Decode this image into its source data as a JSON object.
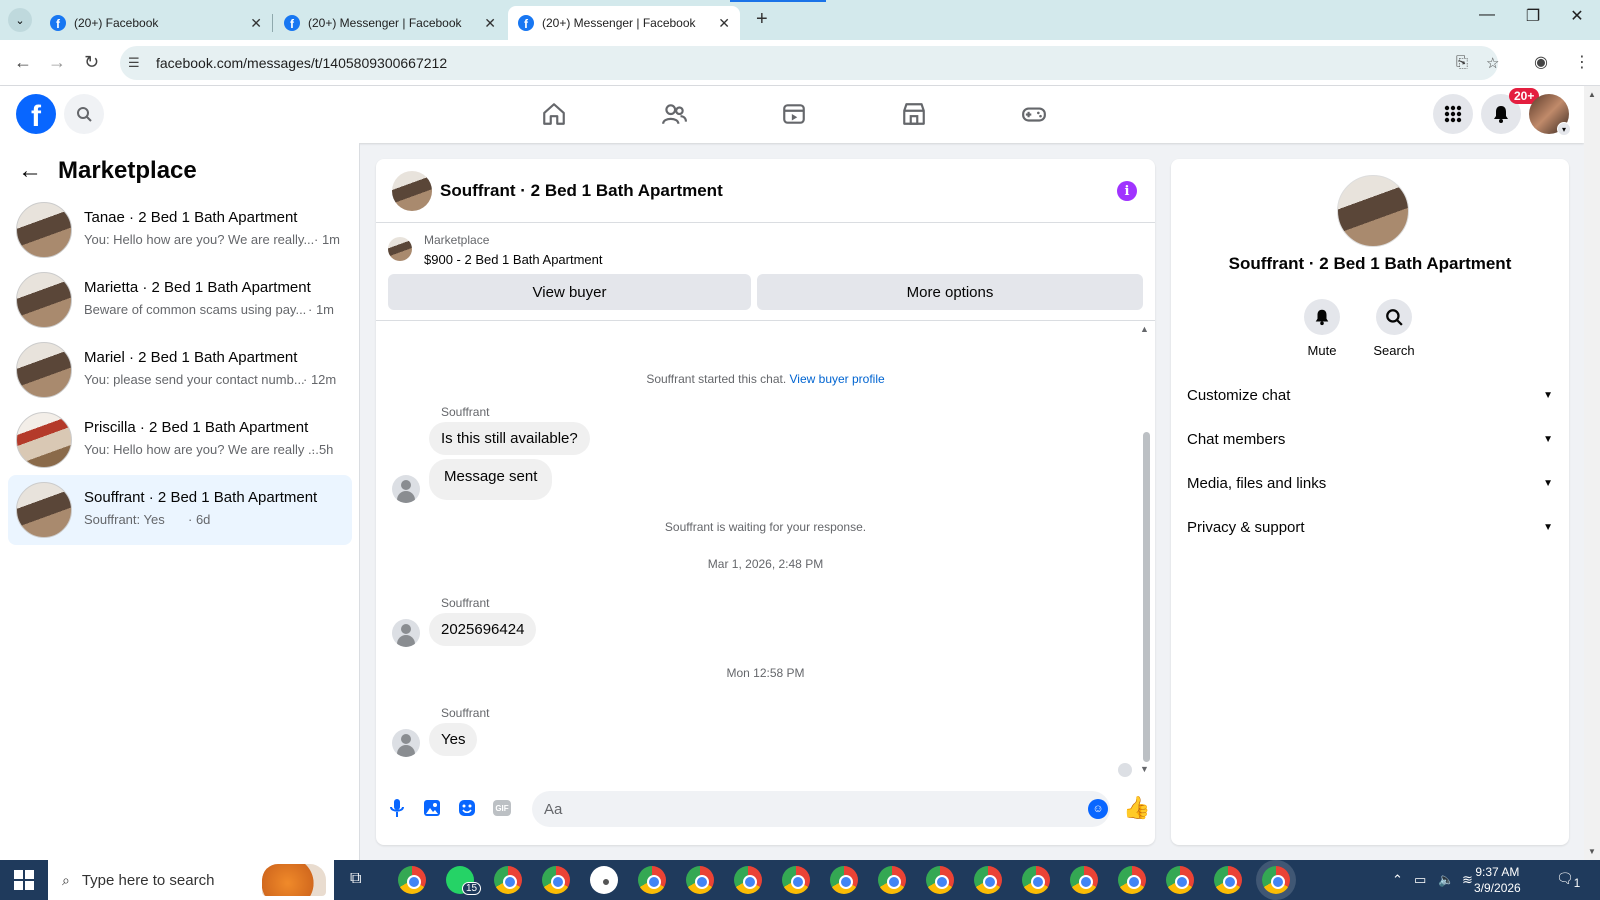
{
  "browser": {
    "tabs": [
      {
        "title": "(20+) Facebook",
        "active": false
      },
      {
        "title": "(20+) Messenger | Facebook",
        "active": false
      },
      {
        "title": "(20+) Messenger | Facebook",
        "active": true
      }
    ],
    "url": "facebook.com/messages/t/1405809300667212"
  },
  "header": {
    "notification_badge": "20+"
  },
  "sidebar": {
    "title": "Marketplace",
    "conversations": [
      {
        "name": "Tanae · 2 Bed 1 Bath Apartment",
        "preview": "You: Hello how are you? We are really...",
        "time": "· 1m",
        "active": false
      },
      {
        "name": "Marietta · 2 Bed 1 Bath Apartment",
        "preview": "Beware of common scams using pay...",
        "time": "· 1m",
        "active": false
      },
      {
        "name": "Mariel · 2 Bed 1 Bath Apartment",
        "preview": "You: please send your contact numb...",
        "time": "· 12m",
        "active": false
      },
      {
        "name": "Priscilla · 2 Bed 1 Bath Apartment",
        "preview": "You: Hello how are you? We are really ...",
        "time": "· 5h",
        "active": false
      },
      {
        "name": "Souffrant · 2 Bed 1 Bath Apartment",
        "preview": "Souffrant: Yes",
        "time": "· 6d",
        "active": true
      }
    ]
  },
  "chat": {
    "title": "Souffrant · 2 Bed 1 Bath Apartment",
    "listing": {
      "source": "Marketplace",
      "title": "$900 - 2 Bed 1 Bath Apartment",
      "view_buyer": "View buyer",
      "more_options": "More options"
    },
    "started_text": "Souffrant started this chat.",
    "view_buyer_profile": "View buyer profile",
    "messages": [
      {
        "sender": "Souffrant",
        "text": "Is this still available?"
      },
      {
        "text": "Message sent"
      },
      {
        "sender": "Souffrant",
        "text": "2025696424"
      },
      {
        "sender": "Souffrant",
        "text": "Yes"
      }
    ],
    "waiting_text": "Souffrant is waiting for your response.",
    "date1": "Mar 1, 2026, 2:48 PM",
    "date2": "Mon 12:58 PM",
    "composer_placeholder": "Aa"
  },
  "info_panel": {
    "name": "Souffrant · 2 Bed 1 Bath Apartment",
    "actions": [
      {
        "label": "Mute",
        "icon": "bell-icon"
      },
      {
        "label": "Search",
        "icon": "search-icon"
      }
    ],
    "sections": [
      "Customize chat",
      "Chat members",
      "Media, files and links",
      "Privacy & support"
    ]
  },
  "taskbar": {
    "search_placeholder": "Type here to search",
    "whatsapp_badge": "15",
    "time": "9:37 AM",
    "date": "3/9/2026",
    "notif_count": "1"
  },
  "colors": {
    "fb_blue": "#0866ff",
    "active_conv_bg": "#ebf5ff",
    "info_purple": "#a033ff",
    "badge_red": "#e41e3f"
  }
}
